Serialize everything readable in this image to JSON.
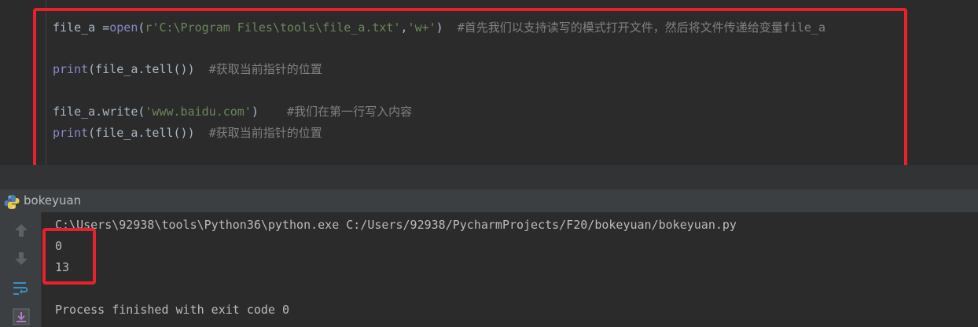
{
  "editor": {
    "line1": {
      "var": "file_a =",
      "fn": "open",
      "p1": "(",
      "s1": "r'C:\\Program Files\\tools\\file_a.txt'",
      "comma": ",",
      "s2": "'w+'",
      "p2": ")  ",
      "comment": "#首先我们以支持读写的模式打开文件，然后将文件传递给变量file_a"
    },
    "line2": {
      "fn": "print",
      "code": "(file_a.tell())  ",
      "comment": "#获取当前指针的位置"
    },
    "line3": {
      "code1": "file_a.write(",
      "s1": "'www.baidu.com'",
      "code2": ")    ",
      "comment": "#我们在第一行写入内容"
    },
    "line4": {
      "fn": "print",
      "code": "(file_a.tell())  ",
      "comment": "#获取当前指针的位置"
    }
  },
  "run_panel": {
    "title": "bokeyuan",
    "console_lines": [
      "C:\\Users\\92938\\tools\\Python36\\python.exe C:/Users/92938/PycharmProjects/F20/bokeyuan/bokeyuan.py",
      "0",
      "13",
      "",
      "Process finished with exit code 0"
    ]
  },
  "icons": {
    "toolbar": [
      "arrow-up-icon",
      "arrow-down-icon",
      "soft-wrap-icon",
      "scroll-to-end-icon"
    ],
    "run_tab": "python-icon"
  },
  "colors": {
    "highlight": "#e8222c",
    "editor_bg": "#2b2b2b",
    "panel_bg": "#3c3f41",
    "string": "#6a8759",
    "builtin": "#8888c6",
    "comment": "#808080",
    "text": "#a9b7c6"
  }
}
